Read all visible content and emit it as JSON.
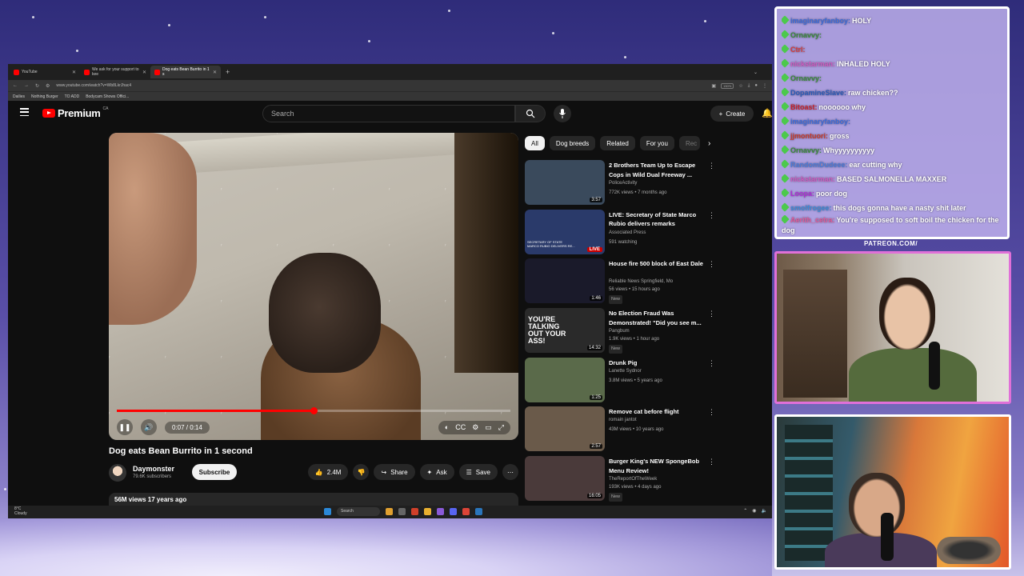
{
  "browser": {
    "tabs": [
      {
        "label": "YouTube",
        "active": false
      },
      {
        "label": "We ask for your support to kee",
        "active": false
      },
      {
        "label": "Dog eats Bean Burrito in 1 s",
        "active": true
      }
    ],
    "url": "www.youtube.com/watch?v=Wb8LkrJhac4",
    "zoom": "150%",
    "bookmarks": [
      "Dailies",
      "Nothing Burger",
      "TO ADD",
      "Bodycam Shows Offici..."
    ]
  },
  "youtube": {
    "logo_text": "Premium",
    "region": "CA",
    "search_placeholder": "Search",
    "create_label": "Create",
    "video": {
      "current_time": "0:07 / 0:14",
      "progress": 0.5,
      "title": "Dog eats Bean Burrito in 1 second",
      "channel": "Daymonster",
      "subscribers": "79.6K subscribers",
      "subscribe_label": "Subscribe",
      "likes": "2.4M",
      "share_label": "Share",
      "ask_label": "Ask",
      "save_label": "Save",
      "views_age": "56M views  17 years ago"
    },
    "chips": [
      "All",
      "Dog breeds",
      "Related",
      "For you",
      "Rec"
    ],
    "recommendations": [
      {
        "title": "2 Brothers Team Up to Escape Cops in Wild Dual Freeway ...",
        "channel": "PoliceActivity",
        "meta": "772K views • 7 months ago",
        "duration": "3:57",
        "badge": "",
        "thumb": "#3a4a5c"
      },
      {
        "title": "LIVE: Secretary of State Marco Rubio delivers remarks",
        "channel": "Associated Press",
        "meta": "591 watching",
        "duration": "LIVE",
        "badge": "",
        "thumb": "#2a3a6a"
      },
      {
        "title": "House fire 500 block of East Dale",
        "channel": "Reliable News Springfield, Mo",
        "meta": "56 views • 15 hours ago",
        "duration": "1:46",
        "badge": "New",
        "thumb": "#1a1a2a"
      },
      {
        "title": "No Election Fraud Was Demonstrated! \"Did you see m...",
        "channel": "Pangbum",
        "meta": "1.9K views • 1 hour ago",
        "duration": "14:32",
        "badge": "New",
        "thumb": "#2a2a2a"
      },
      {
        "title": "Drunk Pig",
        "channel": "Lanette Sydnor",
        "meta": "3.8M views • 5 years ago",
        "duration": "1:25",
        "badge": "",
        "thumb": "#5a6a4a"
      },
      {
        "title": "Remove cat before flight",
        "channel": "romain jantot",
        "meta": "43M views • 10 years ago",
        "duration": "2:57",
        "badge": "",
        "thumb": "#6a5a4a"
      },
      {
        "title": "Burger King's NEW SpongeBob Menu Review!",
        "channel": "TheReportOfTheWeek",
        "meta": "193K views • 4 days ago",
        "duration": "16:05",
        "badge": "New",
        "thumb": "#4a3a3a"
      }
    ],
    "thumb_overlays": {
      "youre_talking": "YOU'RE TALKING OUT YOUR ASS!",
      "rubio_caption": "SECRETARY OF STATE MARCO RUBIO DELIVERS RE..."
    }
  },
  "taskbar": {
    "weather_temp": "8°C",
    "weather_desc": "Cloudy",
    "search_label": "Search"
  },
  "chat": {
    "messages": [
      {
        "user": "imaginaryfanboy:",
        "text": "HOLY",
        "color": "#3a6ad8"
      },
      {
        "user": "Ornavvy:",
        "text": "",
        "color": "#3a8a3a"
      },
      {
        "user": "Ctrl:",
        "text": "",
        "color": "#d83a3a"
      },
      {
        "user": "nickstarman:",
        "text": "INHALED HOLY",
        "color": "#d05ac0"
      },
      {
        "user": "Ornavvy:",
        "text": "",
        "color": "#3a8a3a"
      },
      {
        "user": "DopamineSlave:",
        "text": "raw chicken??",
        "color": "#2a5ab8"
      },
      {
        "user": "Bitoast:",
        "text": "noooooo why",
        "color": "#c8202a"
      },
      {
        "user": "imaginaryfanboy:",
        "text": "",
        "color": "#3a6ad8"
      },
      {
        "user": "jjmontuori:",
        "text": "gross",
        "color": "#c83a2a"
      },
      {
        "user": "Ornavvy:",
        "text": "Whyyyyyyyyyy",
        "color": "#3a8a3a"
      },
      {
        "user": "RandomDudeee:",
        "text": "ear cutting why",
        "color": "#4a7ad8"
      },
      {
        "user": "nickstarman:",
        "text": "BASED SALMONELLA MAXXER",
        "color": "#d05ac0"
      },
      {
        "user": "Loopa:",
        "text": "poor dog",
        "color": "#b02ad8"
      },
      {
        "user": "smolfrogee:",
        "text": "this dogs gonna have a nasty shit later",
        "color": "#3a8ad8"
      },
      {
        "user": "Aerith_cetra:",
        "text": "You're supposed to soft boil the chicken for the dog",
        "color": "#e05a9a"
      }
    ]
  },
  "overlay": {
    "patreon": "PATREON.COM/"
  }
}
